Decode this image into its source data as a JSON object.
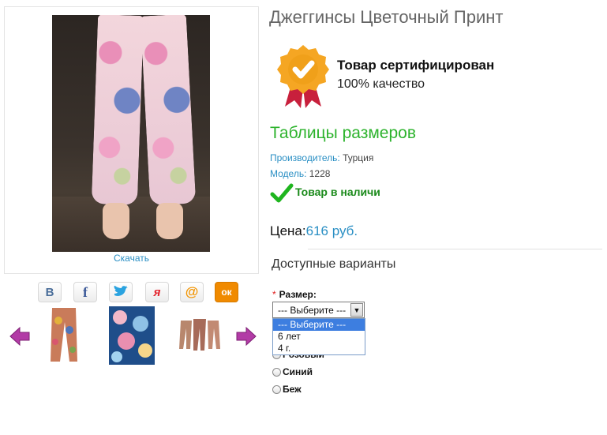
{
  "product": {
    "title": "Джеггинсы Цветочный Принт",
    "download_label": "Скачать"
  },
  "social": {
    "icons": [
      {
        "name": "vk-icon",
        "glyph": "В",
        "color": "#4a6e9a"
      },
      {
        "name": "facebook-icon",
        "glyph": "f",
        "color": "#3b5998"
      },
      {
        "name": "twitter-icon",
        "glyph": "🐦",
        "color": "#2aa3e0"
      },
      {
        "name": "moimir-icon",
        "glyph": "я",
        "color": "#e3262f"
      },
      {
        "name": "mailru-icon",
        "glyph": "@",
        "color": "#f29400"
      },
      {
        "name": "odnoklassniki-icon",
        "glyph": "ок",
        "color": "#f08a00"
      }
    ]
  },
  "certification": {
    "title": "Товар сертифицирован",
    "subtitle": "100% качество"
  },
  "size_table_label": "Таблицы размеров",
  "manufacturer": {
    "label": "Производитель:",
    "value": "Турция"
  },
  "model": {
    "label": "Модель:",
    "value": "1228"
  },
  "stock": {
    "text": "Товар в наличи"
  },
  "price": {
    "label": "Цена:",
    "value": "616 руб."
  },
  "variants": {
    "heading": "Доступные варианты",
    "size_label": "Размер:",
    "required_mark": "*",
    "select": {
      "value": "--- Выберите ---",
      "options": [
        "--- Выберите ---",
        "6 лет",
        "4 г."
      ]
    },
    "colors": [
      "Розовый",
      "Синий",
      "Беж"
    ]
  },
  "colors": {
    "accent_blue": "#2a8fc4",
    "green": "#2db32d",
    "arrow_purple": "#b23ba6",
    "badge_orange": "#f5a623",
    "badge_ribbon": "#c8203c"
  }
}
